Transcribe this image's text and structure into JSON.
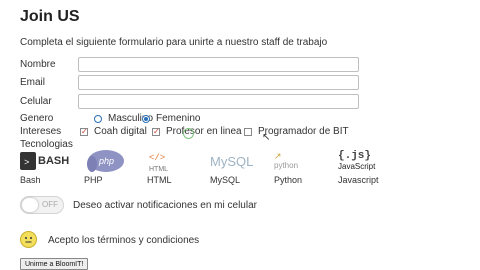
{
  "page": {
    "title": "Join US",
    "subtitle": "Completa el siguiente formulario para unirte a nuestro staff de trabajo"
  },
  "form": {
    "nombre_label": "Nombre",
    "email_label": "Email",
    "celular_label": "Celular",
    "genero_label": "Genero",
    "genero_options": [
      "Masculino",
      "Femenino"
    ],
    "genero_selected": "Femenino",
    "intereses_label": "Intereses",
    "intereses_options": [
      {
        "label": "Coah digital",
        "checked": true
      },
      {
        "label": "Profesor en linea",
        "checked": true
      },
      {
        "label": "Programador de BIT",
        "checked": false
      }
    ],
    "tecnologias_label": "Tecnologias",
    "tecnologias": [
      {
        "name": "Bash",
        "logo_text": "BASH",
        "icon": "bash-icon"
      },
      {
        "name": "PHP",
        "logo_text": "php",
        "icon": "php-elephant-icon"
      },
      {
        "name": "HTML",
        "logo_text": "HTML",
        "icon": "html-icon"
      },
      {
        "name": "MySQL",
        "logo_text": "MySQL",
        "icon": "mysql-icon"
      },
      {
        "name": "Python",
        "logo_text": "python",
        "icon": "python-icon"
      },
      {
        "name": "Javascript",
        "logo_text": "{.js}",
        "logo_sub": "JavaScript",
        "icon": "javascript-icon"
      }
    ],
    "toggle_text": "OFF",
    "toggle_state": "off",
    "notificaciones_label": "Deseo activar notificaciones en mi celular",
    "terminos_label": "Acepto los términos y condiciones",
    "submit_label": "Unirme a BloomIT!"
  }
}
